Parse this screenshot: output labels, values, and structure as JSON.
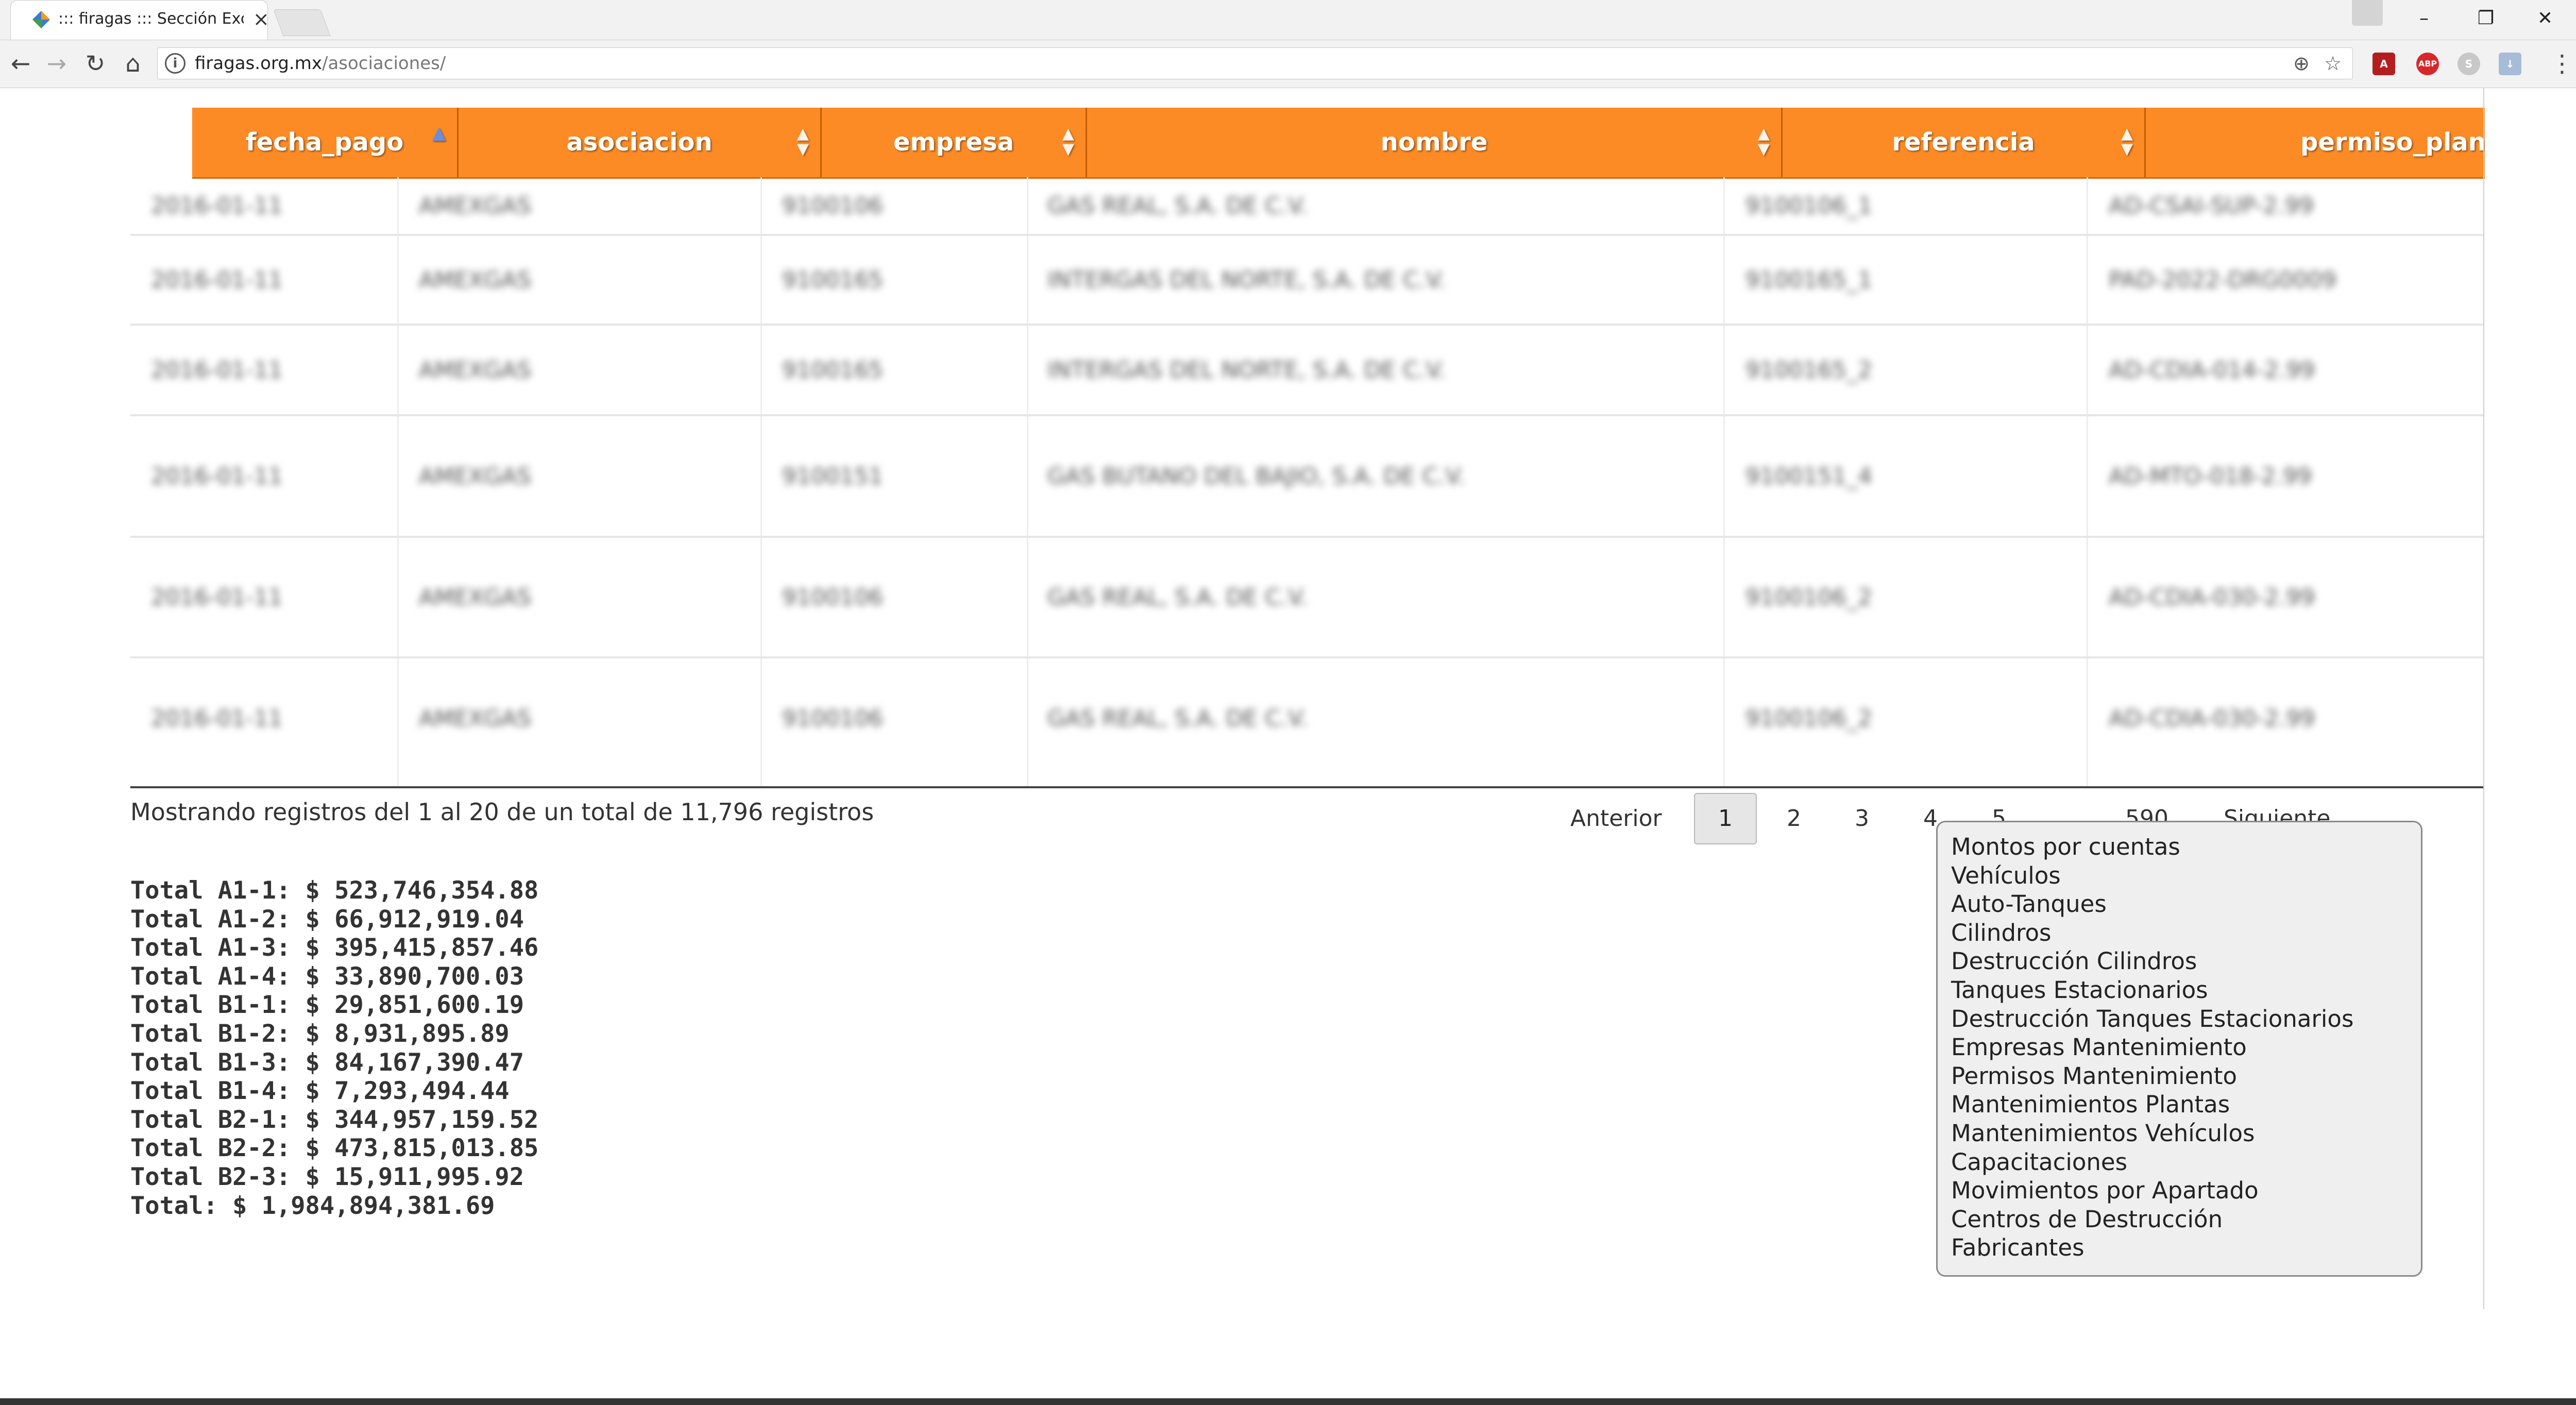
{
  "browser": {
    "tab_title": "::: firagas ::: Sección Exclu",
    "window_controls": {
      "minimize": "–",
      "restore": "❐",
      "close": "✕"
    },
    "nav": {
      "back_icon": "arrow-left-icon",
      "forward_icon": "arrow-right-icon",
      "reload_icon": "reload-icon",
      "home_icon": "home-icon"
    },
    "url_host": "firagas.org.mx",
    "url_path": "/asociaciones/",
    "extensions": [
      {
        "name": "pdf-extension-icon",
        "label": "A",
        "color": "#b41e1e"
      },
      {
        "name": "adblock-plus-icon",
        "label": "ABP",
        "color": "#d7272b"
      },
      {
        "name": "skype-extension-icon",
        "label": "S",
        "color": "#c8c8c8"
      },
      {
        "name": "download-extension-icon",
        "label": "↓",
        "color": "#a7bcd6"
      }
    ]
  },
  "table": {
    "header_color": "#fd8b25",
    "columns": [
      {
        "label": "fecha_pago",
        "sort": "asc"
      },
      {
        "label": "asociacion",
        "sort": "both"
      },
      {
        "label": "empresa",
        "sort": "both"
      },
      {
        "label": "nombre",
        "sort": "both"
      },
      {
        "label": "referencia",
        "sort": "both"
      },
      {
        "label": "permiso_planta",
        "sort": "both"
      }
    ],
    "rows": [
      [
        "2016-01-11",
        "AMEXGAS",
        "9100106",
        "GAS REAL, S.A. DE C.V.",
        "9100106_1",
        "AD-CSAI-SUP-2.99"
      ],
      [
        "2016-01-11",
        "AMEXGAS",
        "9100165",
        "INTERGAS DEL NORTE, S.A. DE C.V.",
        "9100165_1",
        "PAD-2022-DRG0009"
      ],
      [
        "2016-01-11",
        "AMEXGAS",
        "9100165",
        "INTERGAS DEL NORTE, S.A. DE C.V.",
        "9100165_2",
        "AD-CDIA-014-2.99"
      ],
      [
        "2016-01-11",
        "AMEXGAS",
        "9100151",
        "GAS BUTANO DEL BAJIO, S.A. DE C.V.",
        "9100151_4",
        "AD-MTO-018-2.99"
      ],
      [
        "2016-01-11",
        "AMEXGAS",
        "9100106",
        "GAS REAL, S.A. DE C.V.",
        "9100106_2",
        "AD-CDIA-030-2.99"
      ],
      [
        "2016-01-11",
        "AMEXGAS",
        "9100106",
        "GAS REAL, S.A. DE C.V.",
        "9100106_2",
        "AD-CDIA-030-2.99"
      ]
    ]
  },
  "info": "Mostrando registros del 1 al 20 de un total de 11,796 registros",
  "pagination": {
    "previous": "Anterior",
    "current": "1",
    "pages": [
      "2",
      "3",
      "4",
      "5"
    ],
    "ellipsis": "…",
    "last": "590",
    "next": "Siguiente"
  },
  "totals": [
    "Total A1-1: $ 523,746,354.88",
    "Total A1-2: $ 66,912,919.04",
    "Total A1-3: $ 395,415,857.46",
    "Total A1-4: $ 33,890,700.03",
    "Total B1-1: $ 29,851,600.19",
    "Total B1-2: $ 8,931,895.89",
    "Total B1-3: $ 84,167,390.47",
    "Total B1-4: $ 7,293,494.44",
    "Total B2-1: $ 344,957,159.52",
    "Total B2-2: $ 473,815,013.85",
    "Total B2-3: $ 15,911,995.92",
    "Total: $ 1,984,894,381.69"
  ],
  "side_menu": [
    "Montos por cuentas",
    "Vehículos",
    "Auto-Tanques",
    "Cilindros",
    "Destrucción Cilindros",
    "Tanques Estacionarios",
    "Destrucción Tanques Estacionarios",
    "Empresas Mantenimiento",
    "Permisos Mantenimiento",
    "Mantenimientos Plantas",
    "Mantenimientos Vehículos",
    "Capacitaciones",
    "Movimientos por Apartado",
    "Centros de Destrucción",
    "Fabricantes"
  ]
}
